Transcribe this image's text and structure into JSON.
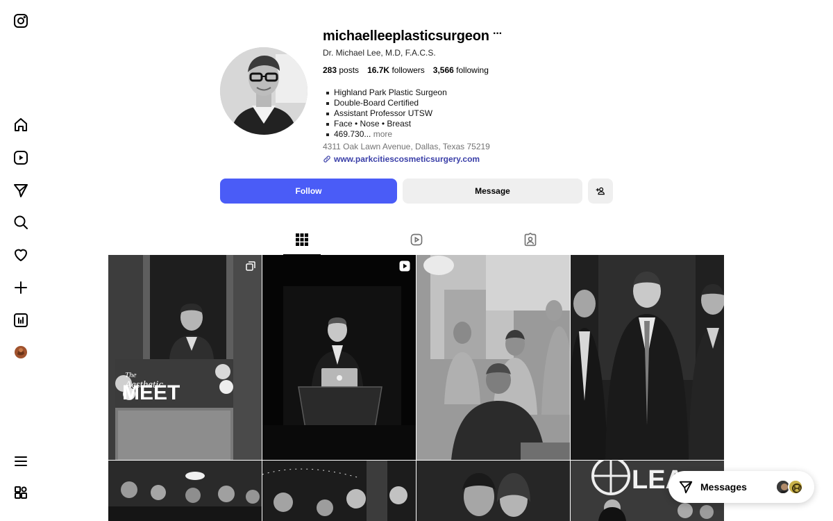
{
  "nav": {
    "items": [
      "instagram-logo",
      "home",
      "reels",
      "messages",
      "search",
      "notifications",
      "create",
      "dashboard",
      "profile"
    ],
    "bottom": [
      "more",
      "also-from-meta"
    ]
  },
  "profile": {
    "username": "michaelleeplasticsurgeon",
    "more_label": "···",
    "full_name": "Dr. Michael Lee, M.D, F.A.C.S.",
    "posts_count": "283",
    "posts_label": "posts",
    "followers_count": "16.7K",
    "followers_label": "followers",
    "following_count": "3,566",
    "following_label": "following",
    "bio": [
      "Highland Park Plastic Surgeon",
      "Double-Board Certified",
      "Assistant Professor UTSW",
      "Face • Nose • Breast",
      "469.730..."
    ],
    "more_link": "more",
    "address": "4311 Oak Lawn Avenue, Dallas, Texas 75219",
    "website": "www.parkcitiescosmeticsurgery.com"
  },
  "actions": {
    "follow": "Follow",
    "message": "Message"
  },
  "tabs": {
    "active": "posts",
    "items": [
      "posts",
      "reels",
      "tagged"
    ]
  },
  "posts": {
    "p1_text1": "The",
    "p1_text2": "Aesthetic",
    "p1_text3": "MEET",
    "p8_text": "LEA"
  },
  "messages_dock": {
    "label": "Messages"
  },
  "colors": {
    "follow_bg": "#4a5cf7",
    "secondary_bg": "#efefef",
    "link": "#3a3fa8"
  }
}
